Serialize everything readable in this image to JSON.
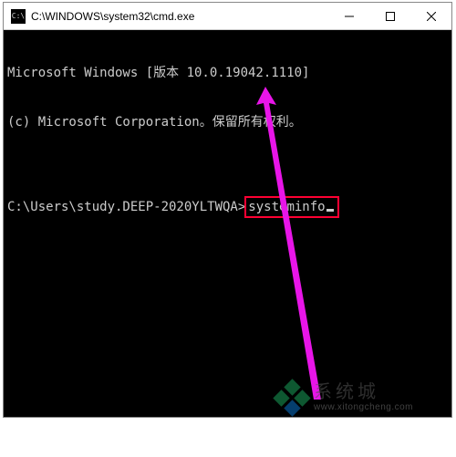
{
  "window": {
    "title": "C:\\WINDOWS\\system32\\cmd.exe",
    "icon_label": "cmd-icon"
  },
  "terminal": {
    "line1": "Microsoft Windows [版本 10.0.19042.1110]",
    "line2": "(c) Microsoft Corporation。保留所有权利。",
    "blank": "",
    "prompt": "C:\\Users\\study.DEEP-2020YLTWQA>",
    "command": "systeminfo"
  },
  "annotation": {
    "highlight_color": "#ff0033",
    "arrow_color": "#e815e8"
  },
  "watermark": {
    "cn": "系统城",
    "url": "www.xitongcheng.com"
  }
}
